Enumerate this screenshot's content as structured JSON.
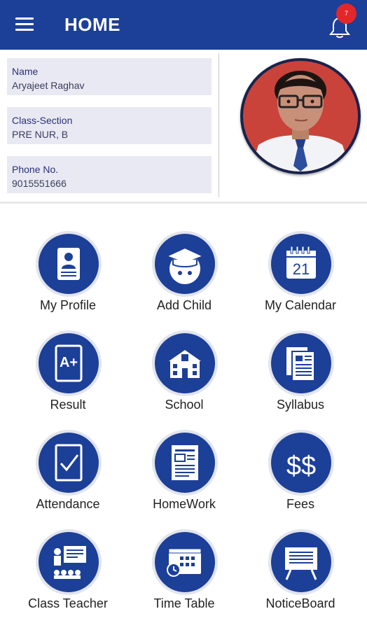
{
  "app_bar": {
    "title": "HOME",
    "notification_count": "7"
  },
  "student": {
    "fields": [
      {
        "label": "Name",
        "value": "Aryajeet Raghav"
      },
      {
        "label": "Class-Section",
        "value": "PRE NUR, B"
      },
      {
        "label": "Phone No.",
        "value": "9015551666"
      }
    ]
  },
  "menu": {
    "items": [
      {
        "label": "My Profile",
        "icon": "id-card-icon"
      },
      {
        "label": "Add Child",
        "icon": "graduate-face-icon"
      },
      {
        "label": "My Calendar",
        "icon": "calendar-icon",
        "calendar_day": "21"
      },
      {
        "label": "Result",
        "icon": "grade-report-icon",
        "grade": "A+"
      },
      {
        "label": "School",
        "icon": "school-building-icon"
      },
      {
        "label": "Syllabus",
        "icon": "documents-icon"
      },
      {
        "label": "Attendance",
        "icon": "checkbox-icon"
      },
      {
        "label": "HomeWork",
        "icon": "notebook-icon"
      },
      {
        "label": "Fees",
        "icon": "dollar-icon",
        "symbol": "$$"
      },
      {
        "label": "Class Teacher",
        "icon": "teacher-board-icon"
      },
      {
        "label": "Time Table",
        "icon": "timetable-icon"
      },
      {
        "label": "NoticeBoard",
        "icon": "notice-board-icon"
      }
    ]
  },
  "colors": {
    "primary": "#1c3f98",
    "field_bg": "#e8e9f2",
    "badge": "#e3262a"
  }
}
